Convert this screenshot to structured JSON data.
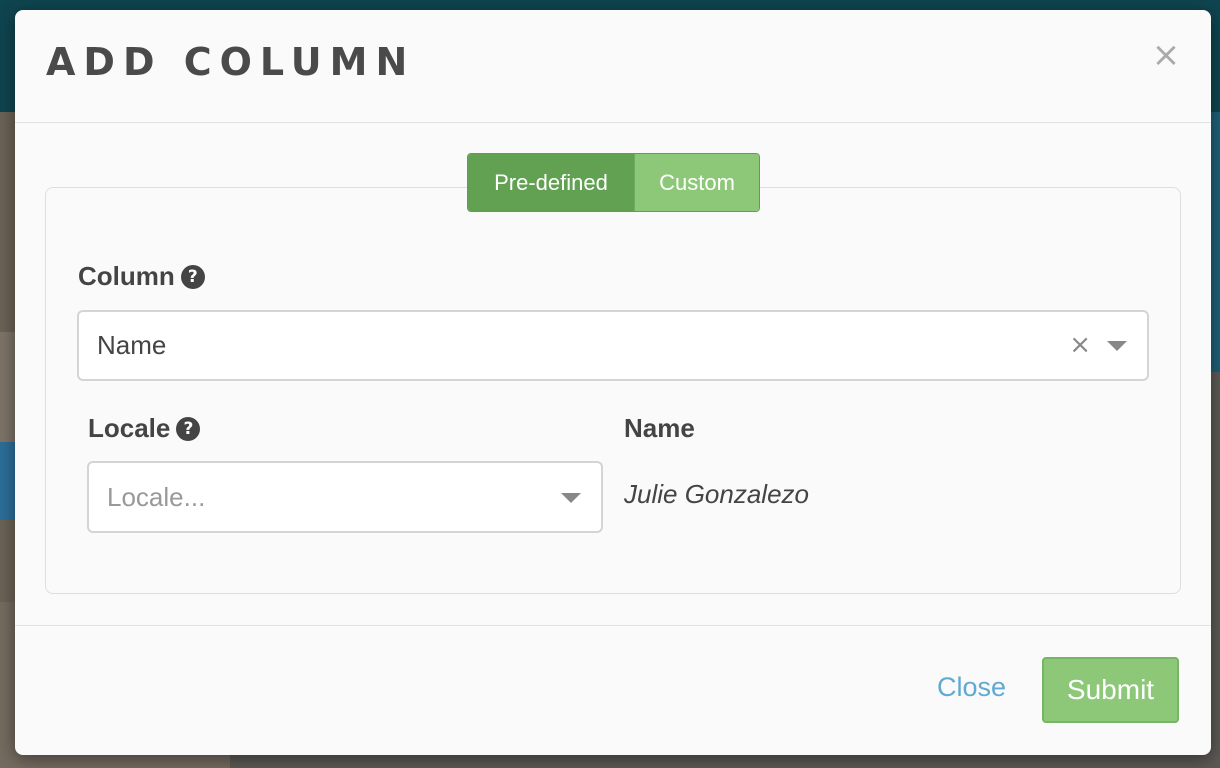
{
  "modal": {
    "title": "ADD COLUMN",
    "close_icon": "times-icon"
  },
  "tabs": {
    "predefined": "Pre-defined",
    "custom": "Custom",
    "active": "predefined"
  },
  "column_field": {
    "label": "Column",
    "help_icon": "question-circle-icon",
    "value": "Name",
    "clear_glyph": "×"
  },
  "locale_field": {
    "label": "Locale",
    "help_icon": "question-circle-icon",
    "placeholder": "Locale..."
  },
  "preview": {
    "label": "Name",
    "value": "Julie Gonzalezo"
  },
  "footer": {
    "close_label": "Close",
    "submit_label": "Submit"
  },
  "colors": {
    "active_toggle": "#62a152",
    "inactive_toggle": "#8cc878",
    "submit": "#8cc878",
    "link": "#5fa9d3",
    "text": "#444444"
  }
}
